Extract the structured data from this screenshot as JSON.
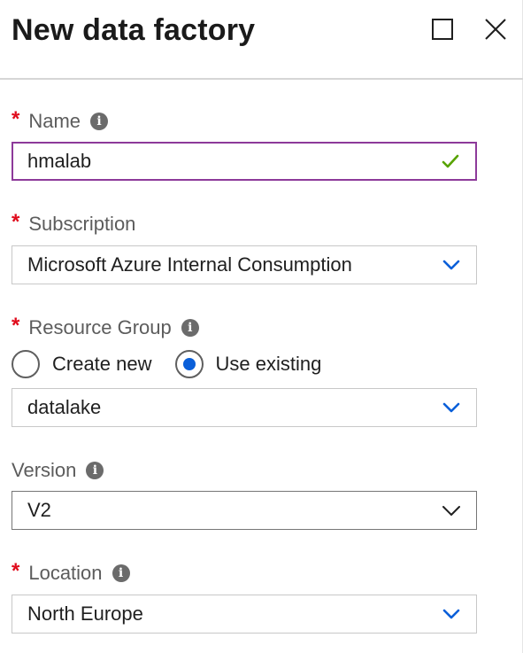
{
  "blade": {
    "title": "New data factory"
  },
  "form": {
    "name": {
      "label": "Name",
      "required": true,
      "value": "hmalab"
    },
    "subscription": {
      "label": "Subscription",
      "required": true,
      "value": "Microsoft Azure Internal Consumption"
    },
    "resource_group": {
      "label": "Resource Group",
      "required": true,
      "options": [
        {
          "label": "Create new",
          "selected": false
        },
        {
          "label": "Use existing",
          "selected": true
        }
      ],
      "value": "datalake"
    },
    "version": {
      "label": "Version",
      "required": false,
      "value": "V2"
    },
    "location": {
      "label": "Location",
      "required": true,
      "value": "North Europe"
    }
  },
  "icons": {
    "required_marker": "*",
    "info": "i"
  },
  "colors": {
    "required": "#e00b1c",
    "focus_border": "#8d3a9a",
    "valid_check": "#57a300",
    "chevron_blue": "#0a5fd9",
    "radio_selected": "#0a5fd9"
  }
}
